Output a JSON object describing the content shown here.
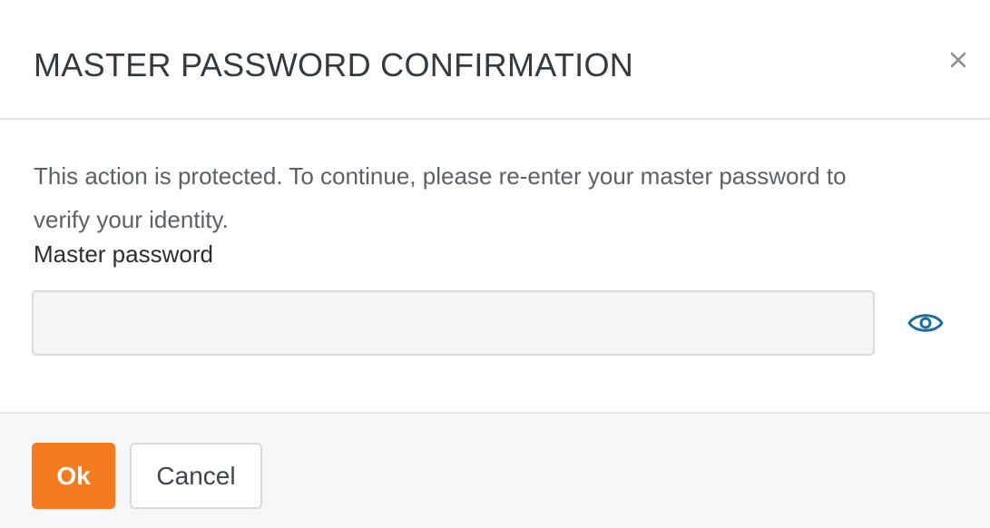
{
  "dialog": {
    "title": "MASTER PASSWORD CONFIRMATION",
    "close_icon": "close-icon",
    "description": "This action is protected. To continue, please re-enter your master password to verify your identity.",
    "field_label": "Master password",
    "password_value": "",
    "password_placeholder": "",
    "visibility_icon": "eye-icon",
    "ok_label": "Ok",
    "cancel_label": "Cancel"
  },
  "colors": {
    "accent": "#f47b20",
    "eye_icon": "#1f6e9c",
    "title_text": "#333a40",
    "body_text": "#5a6168",
    "footer_bg": "#f6f7f8",
    "border": "#e3e6e9"
  }
}
